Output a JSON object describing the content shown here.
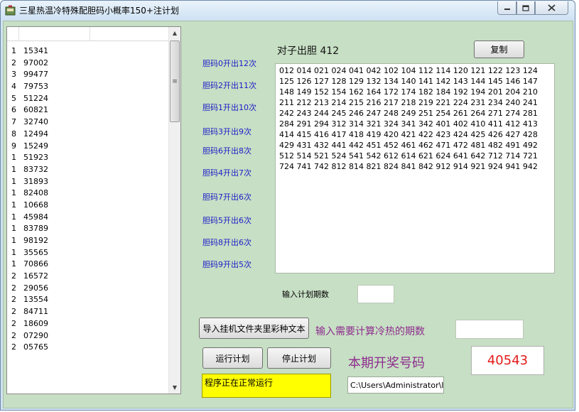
{
  "window": {
    "title": "三星热温冷特殊配胆码小概率150+注计划"
  },
  "list": {
    "rows": [
      {
        "a": "1",
        "b": "15341"
      },
      {
        "a": "2",
        "b": "97002"
      },
      {
        "a": "3",
        "b": "99477"
      },
      {
        "a": "4",
        "b": "79753"
      },
      {
        "a": "5",
        "b": "51224"
      },
      {
        "a": "6",
        "b": "60821"
      },
      {
        "a": "7",
        "b": "32740"
      },
      {
        "a": "8",
        "b": "12494"
      },
      {
        "a": "9",
        "b": "15249"
      },
      {
        "a": "1",
        "b": "51923"
      },
      {
        "a": "1",
        "b": "83732"
      },
      {
        "a": "1",
        "b": "31893"
      },
      {
        "a": "1",
        "b": "82408"
      },
      {
        "a": "1",
        "b": "10668"
      },
      {
        "a": "1",
        "b": "45984"
      },
      {
        "a": "1",
        "b": "83789"
      },
      {
        "a": "1",
        "b": "98192"
      },
      {
        "a": "1",
        "b": "35565"
      },
      {
        "a": "1",
        "b": "70866"
      },
      {
        "a": "2",
        "b": "16572"
      },
      {
        "a": "2",
        "b": "29056"
      },
      {
        "a": "2",
        "b": "13554"
      },
      {
        "a": "2",
        "b": "84711"
      },
      {
        "a": "2",
        "b": "18609"
      },
      {
        "a": "2",
        "b": "07290"
      },
      {
        "a": "2",
        "b": "05765"
      }
    ]
  },
  "stats": [
    "胆码0开出12次",
    "胆码2开出11次",
    "胆码1开出10次",
    "胆码3开出9次",
    "胆码6开出8次",
    "胆码4开出7次",
    "胆码7开出6次",
    "胆码5开出6次",
    "胆码8开出6次",
    "胆码9开出5次"
  ],
  "heading": "对子出胆 412",
  "copy_label": "复制",
  "result_text": "012 014 021 024 041 042 102 104 112 114 120 121 122 123 124 125 126 127 128 129 132 134 140 141 142 143 144 145 146 147 148 149 152 154 162 164 172 174 182 184 192 194 201 204 210 211 212 213 214 215 216 217 218 219 221 224 231 234 240 241 242 243 244 245 246 247 248 249 251 254 261 264 271 274 281 284 291 294 312 314 321 324 341 342 401 402 410 411 412 413 414 415 416 417 418 419 420 421 422 423 424 425 426 427 428 429 431 432 441 442 451 452 461 462 471 472 481 482 491 492 512 514 521 524 541 542 612 614 621 624 641 642 712 714 721 724 741 742 812 814 821 824 841 842 912 914 921 924 941 942",
  "plan_periods_label": "输入计划期数",
  "plan_periods_value": "",
  "import_button": "导入挂机文件夹里彩种文本",
  "hotcold_label": "输入需要计算冷热的期数",
  "hotcold_value": "",
  "run_button": "运行计划",
  "stop_button": "停止计划",
  "status_text": "程序正在正常运行",
  "current_draw_label": "本期开奖号码",
  "current_draw_value": "40543",
  "path_value": "C:\\Users\\Administrator\\I"
}
